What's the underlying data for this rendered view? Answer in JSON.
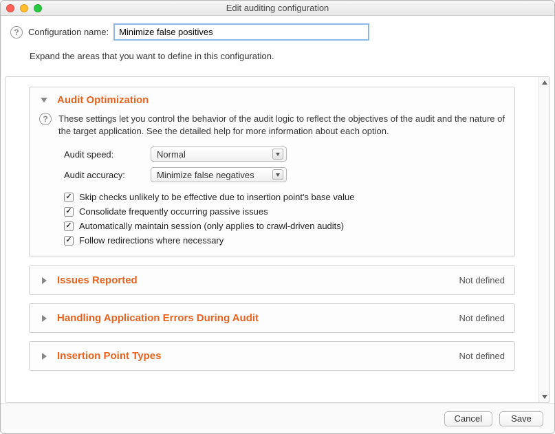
{
  "window": {
    "title": "Edit auditing configuration"
  },
  "header": {
    "config_name_label": "Configuration name:",
    "config_name_value": "Minimize false positives",
    "expand_hint": "Expand the areas that you want to define in this configuration."
  },
  "sections": {
    "opt": {
      "title": "Audit Optimization",
      "description": "These settings let you control the behavior of the audit logic to reflect the objectives of the audit and the nature of the target application. See the detailed help for more information about each option.",
      "speed_label": "Audit speed:",
      "speed_value": "Normal",
      "accuracy_label": "Audit accuracy:",
      "accuracy_value": "Minimize false negatives",
      "checks": {
        "skip": {
          "label": "Skip checks unlikely to be effective due to insertion point's base value",
          "checked": true
        },
        "consolidate": {
          "label": "Consolidate frequently occurring passive issues",
          "checked": true
        },
        "session": {
          "label": "Automatically maintain session (only applies to crawl-driven audits)",
          "checked": true
        },
        "redirect": {
          "label": "Follow redirections where necessary",
          "checked": true
        }
      }
    },
    "issues": {
      "title": "Issues Reported",
      "status": "Not defined"
    },
    "errors": {
      "title": "Handling Application Errors During Audit",
      "status": "Not defined"
    },
    "insertion": {
      "title": "Insertion Point Types",
      "status": "Not defined"
    }
  },
  "footer": {
    "cancel": "Cancel",
    "save": "Save"
  }
}
